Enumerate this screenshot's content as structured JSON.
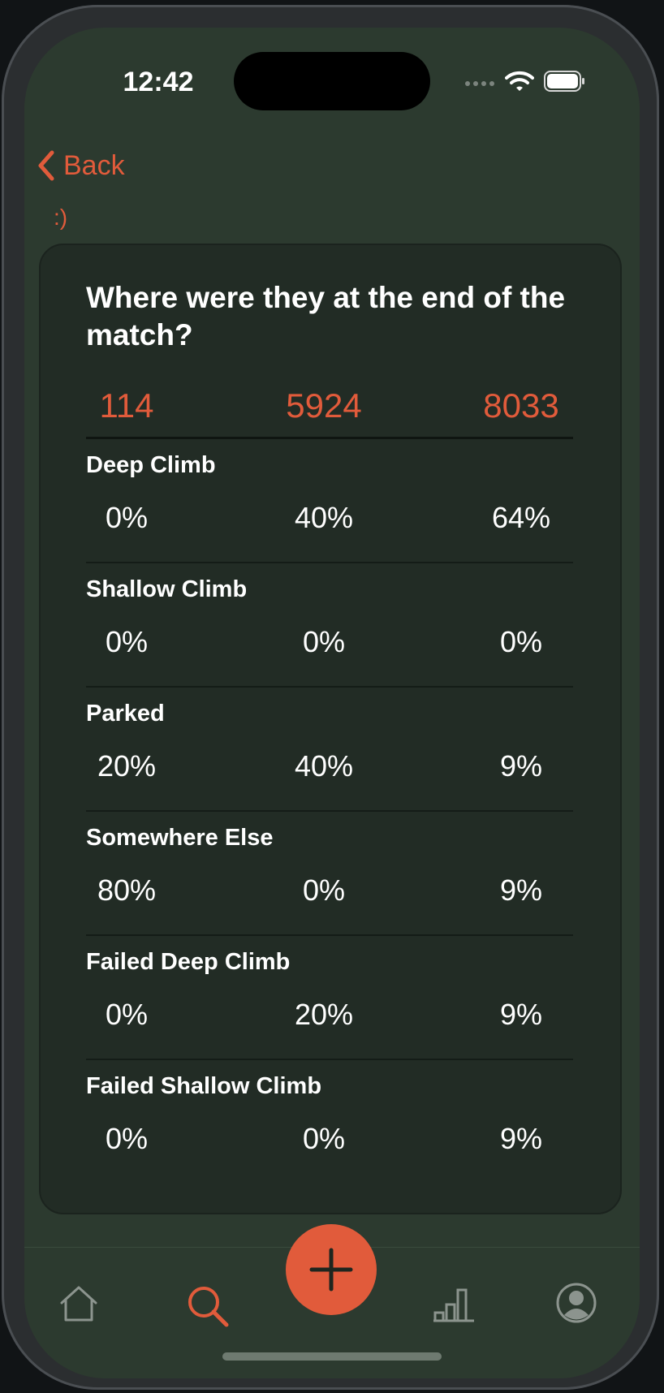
{
  "status_bar": {
    "time": "12:42"
  },
  "nav": {
    "back_label": "Back",
    "subtitle": ":)"
  },
  "card": {
    "question": "Where were they at the end of the match?",
    "teams": [
      "114",
      "5924",
      "8033"
    ],
    "rows": [
      {
        "label": "Deep Climb",
        "values": [
          "0%",
          "40%",
          "64%"
        ]
      },
      {
        "label": "Shallow Climb",
        "values": [
          "0%",
          "0%",
          "0%"
        ]
      },
      {
        "label": "Parked",
        "values": [
          "20%",
          "40%",
          "9%"
        ]
      },
      {
        "label": "Somewhere Else",
        "values": [
          "80%",
          "0%",
          "9%"
        ]
      },
      {
        "label": "Failed Deep Climb",
        "values": [
          "0%",
          "20%",
          "9%"
        ]
      },
      {
        "label": "Failed Shallow Climb",
        "values": [
          "0%",
          "0%",
          "9%"
        ]
      }
    ]
  },
  "tab_bar": {
    "tabs": [
      {
        "icon": "home-icon"
      },
      {
        "icon": "search-icon",
        "active": true
      },
      {
        "icon": "plus-icon"
      },
      {
        "icon": "bar-chart-icon"
      },
      {
        "icon": "profile-icon"
      }
    ]
  },
  "colors": {
    "accent": "#e15b3b",
    "background": "#2c3a2f",
    "card": "#222c25"
  }
}
